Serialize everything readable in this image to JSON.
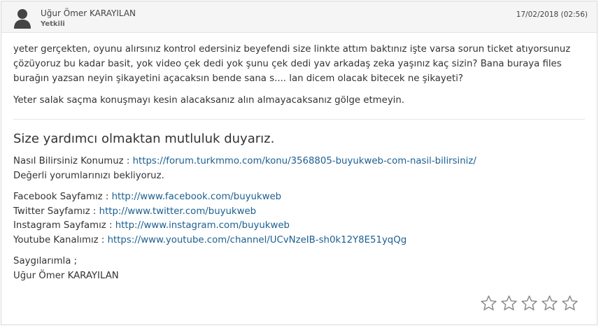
{
  "author": {
    "name": "Uğur Ömer KARAYILAN",
    "role": "Yetkili"
  },
  "timestamp": "17/02/2018 (02:56)",
  "message": {
    "paragraphs": [
      "yeter gerçekten, oyunu alırsınız kontrol edersiniz beyefendi size linkte attım baktınız işte varsa sorun ticket atıyorsunuz çözüyoruz bu kadar basit, yok video çek dedi yok şunu çek dedi yav arkadaş zeka yaşınız kaç sizin? Bana buraya files burağın yazsan neyin şikayetini açacaksın bende sana s.... lan dicem olacak bitecek ne şikayeti?",
      "Yeter salak saçma konuşmayı kesin alacaksanız alın almayacaksanız gölge etmeyin."
    ]
  },
  "signature": {
    "title": "Size yardımcı olmaktan mutluluk duyarız.",
    "topic_label": "Nasıl Bilirsiniz Konumuz : ",
    "topic_url": "https://forum.turkmmo.com/konu/3568805-buyukweb-com-nasil-bilirsiniz/",
    "comments_text": "Değerli yorumlarınızı bekliyoruz.",
    "facebook_label": "Facebook Sayfamız : ",
    "facebook_url": "http://www.facebook.com/buyukweb",
    "twitter_label": "Twitter Sayfamız : ",
    "twitter_url": "http://www.twitter.com/buyukweb",
    "instagram_label": "Instagram Sayfamız : ",
    "instagram_url": "http://www.instagram.com/buyukweb",
    "youtube_label": "Youtube Kanalımız : ",
    "youtube_url": "https://www.youtube.com/channel/UCvNzeIB-sh0k12Y8E51yqQg",
    "regards": "Saygılarımla ;",
    "signer": "Uğur Ömer KARAYILAN"
  },
  "rating": {
    "value": 0,
    "max": 5
  },
  "icons": {
    "avatar": "user-icon",
    "rating": "star-outline-icon"
  },
  "colors": {
    "link": "#1c5f90",
    "star_outline": "#888888"
  }
}
